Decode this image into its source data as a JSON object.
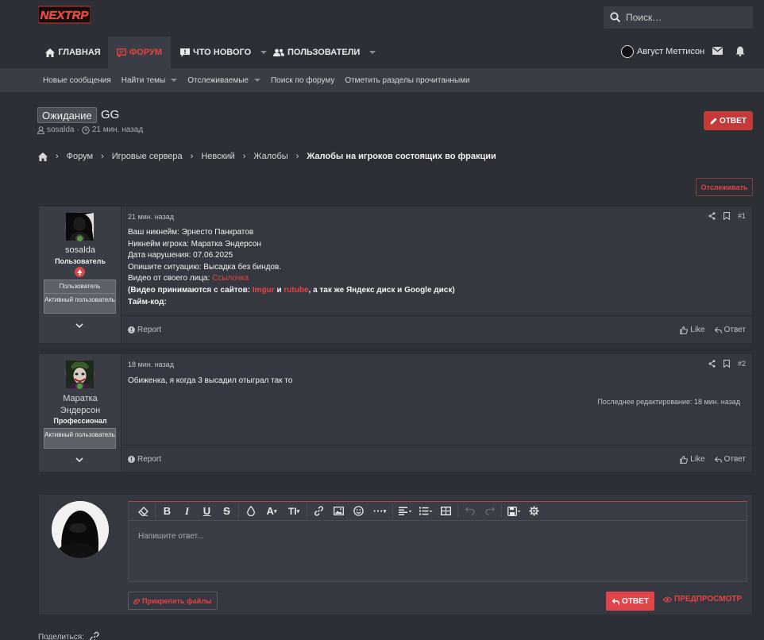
{
  "brand": {
    "logo_text": "NEXTRP",
    "accent": "#e8423f"
  },
  "search": {
    "placeholder": "Поиск…"
  },
  "nav": {
    "tabs": [
      {
        "label": "ГЛАВНАЯ",
        "icon": "home-icon"
      },
      {
        "label": "ФОРУМ",
        "icon": "forum-icon",
        "active": true
      },
      {
        "label": "ЧТО НОВОГО",
        "icon": "comment-icon"
      },
      {
        "label": "ПОЛЬЗОВАТЕЛИ",
        "icon": "users-icon"
      }
    ],
    "user_name": "Август Меттисон"
  },
  "subnav": {
    "items": [
      "Новые сообщения",
      "Найти темы",
      "Отслеживаемые",
      "Поиск по форуму",
      "Отметить разделы прочитанными"
    ]
  },
  "thread": {
    "prefix": "Ожидание",
    "title": "GG",
    "author": "sosalda",
    "time": "21 мин. назад",
    "reply_label": "ОТВЕТ",
    "watch_label": "Отслеживать"
  },
  "breadcrumb": [
    "Форум",
    "Игровые сервера",
    "Невский",
    "Жалобы",
    "Жалобы на игроков состоящих во фракции"
  ],
  "posts": [
    {
      "username": "sosalda",
      "user_title": "Пользователь",
      "banners": [
        "Пользователь",
        "Активный пользователь"
      ],
      "date": "21 мин. назад",
      "number": "#1",
      "lines": {
        "l1": "Ваш никнейм: Эрнесто Панкратов",
        "l2": "Никнейм игрока: Маратка Эндерсон",
        "l3": "Дата нарушения: 07.06.2025",
        "l4": "Опишите ситуацию: Высадка без биндов.",
        "l5a": "Видео от своего лица: ",
        "l5b": "Ссылочка",
        "l6a": "(Видео принимаются с сайтов: ",
        "l6b": "Imgur",
        "l6c": " и ",
        "l6d": "rutube",
        "l6e": ", а так же Яндекс диск и Google диск)",
        "l7": "Тайм-код:"
      },
      "report": "Report",
      "like": "Like",
      "reply": "Ответ"
    },
    {
      "username": "Маратка Эндерсон",
      "user_title": "Профессионал",
      "banners": [
        "Активный пользователь"
      ],
      "date": "18 мин. назад",
      "number": "#2",
      "text": "Обиженка, я когда 3 высадил отыграл так то",
      "edited": "Последнее редактирование: 18 мин. назад",
      "report": "Report",
      "like": "Like",
      "reply": "Ответ"
    }
  ],
  "reply_box": {
    "placeholder": "Напишите ответ...",
    "attach_label": "Прикрепить файлы",
    "send_label": "ОТВЕТ",
    "preview_label": "ПРЕДПРОСМОТР"
  },
  "share_label": "Поделиться:"
}
